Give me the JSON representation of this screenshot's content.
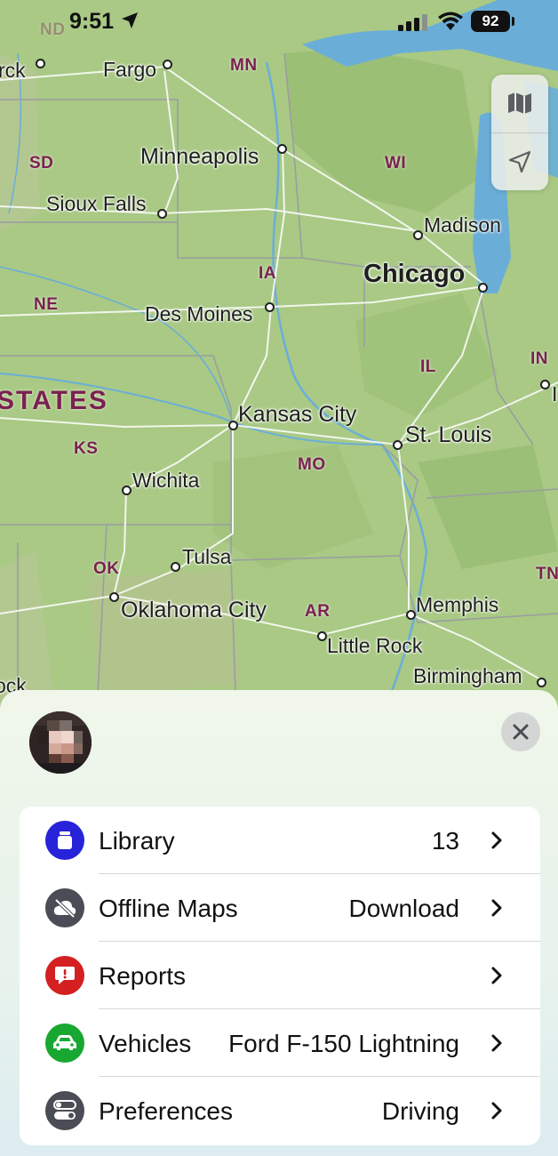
{
  "status_bar": {
    "time": "9:51",
    "battery": "92"
  },
  "map": {
    "country_label": "STATES",
    "states": [
      "MN",
      "SD",
      "WI",
      "IA",
      "NE",
      "IL",
      "IN",
      "KS",
      "MO",
      "OK",
      "AR",
      "TN",
      "ND"
    ],
    "cities": [
      "Fargo",
      "Minneapolis",
      "Sioux Falls",
      "Madison",
      "Chicago",
      "Des Moines",
      "Kansas City",
      "St. Louis",
      "Wichita",
      "Tulsa",
      "Oklahoma City",
      "Memphis",
      "Little Rock",
      "Birmingham",
      "rck",
      "ock",
      "I"
    ],
    "colors": {
      "land": "#a7c982",
      "water": "#6aaed8",
      "roads": "#ffffff"
    }
  },
  "sheet": {
    "close_icon": "xmark",
    "rows": [
      {
        "label": "Library",
        "value": "13",
        "icon": "library-icon",
        "color": "#2623d9"
      },
      {
        "label": "Offline Maps",
        "value": "Download",
        "icon": "offline-maps-icon",
        "color": "#4a4d55"
      },
      {
        "label": "Reports",
        "value": "",
        "icon": "reports-icon",
        "color": "#d42020"
      },
      {
        "label": "Vehicles",
        "value": "Ford F-150 Lightning",
        "icon": "car-icon",
        "color": "#18a832"
      },
      {
        "label": "Preferences",
        "value": "Driving",
        "icon": "toggle-icon",
        "color": "#4a4d55"
      }
    ]
  }
}
